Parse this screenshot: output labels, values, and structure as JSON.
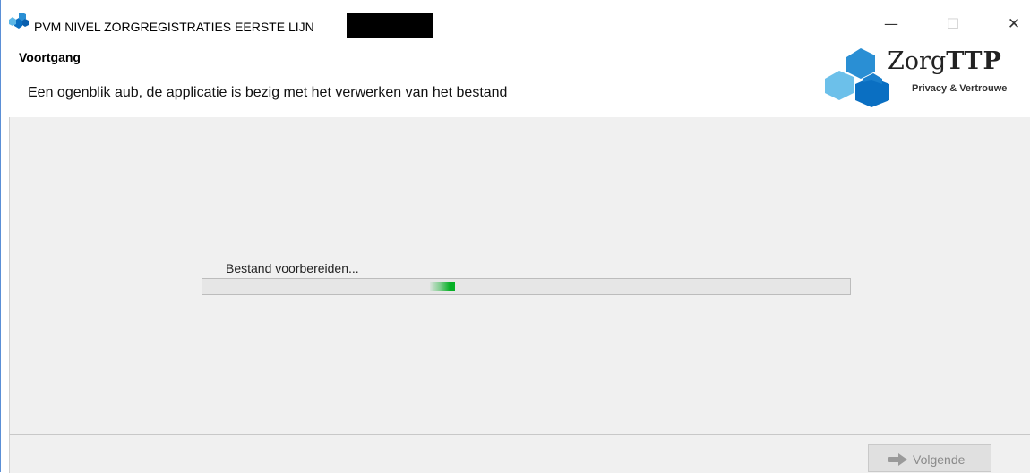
{
  "window": {
    "title": "PVM NIVEL ZORGREGISTRATIES EERSTE LIJN",
    "controls": {
      "minimize": "—",
      "maximize": "☐",
      "close": "✕"
    }
  },
  "header": {
    "title": "Voortgang",
    "subtitle": "Een ogenblik aub, de applicatie is bezig met het verwerken van het bestand"
  },
  "logo": {
    "name_plain": "Zorg",
    "name_bold": "TTP",
    "tagline": "Privacy & Vertrouwe"
  },
  "progress": {
    "label": "Bestand voorbereiden...",
    "indeterminate": true
  },
  "footer": {
    "next_label": "Volgende",
    "next_icon": "arrow-right-icon"
  },
  "colors": {
    "progress_fill": "#06b025",
    "logo_blue_dark": "#0a6fc2",
    "logo_blue_light": "#5bb6e6",
    "window_border": "#5b8fd6"
  }
}
